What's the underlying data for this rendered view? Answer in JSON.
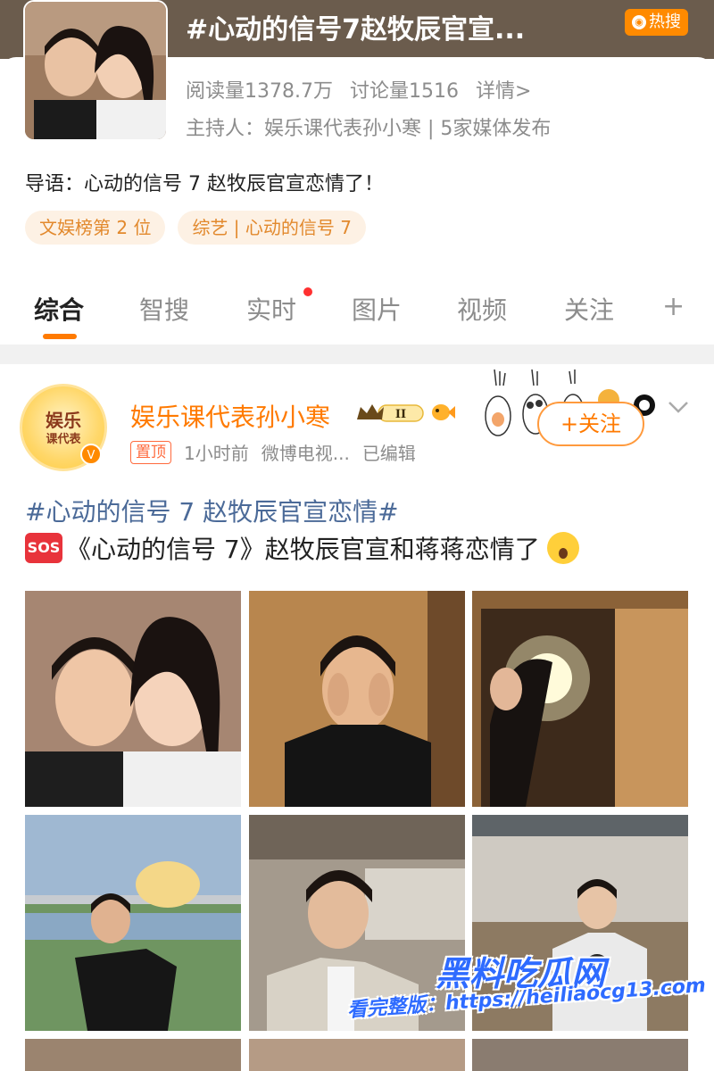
{
  "topic": {
    "title": "#心动的信号7赵牧辰官宣...",
    "hot_badge": "热搜",
    "reads": "阅读量1378.7万",
    "discussions": "讨论量1516",
    "details": "详情>",
    "host_line": "主持人：娱乐课代表孙小寒 | 5家媒体发布",
    "intro": "导语：心动的信号 7 赵牧辰官宣恋情了！",
    "chips": [
      "文娱榜第 2 位",
      "综艺 | 心动的信号 7"
    ]
  },
  "tabs": [
    "综合",
    "智搜",
    "实时",
    "图片",
    "视频",
    "关注"
  ],
  "tabs_plus": "+",
  "post": {
    "avatar_text_line1": "娱乐",
    "avatar_text_line2": "课代表",
    "author": "娱乐课代表孙小寒",
    "level_badge": "II",
    "pinned": "置顶",
    "time": "1小时前",
    "source": "微博电视...",
    "edited": "已编辑",
    "follow_label": "+关注",
    "hashtag": "#心动的信号 7 赵牧辰官宣恋情#",
    "sos_label": "SOS",
    "body": "《心动的信号 7》赵牧辰官宣和蒋蒋恋情了"
  },
  "watermark": {
    "brand": "黑料吃瓜网",
    "url_line": "看完整版：https://heiliaocg13.com"
  },
  "colors": {
    "accent": "#ff7a00",
    "hashtag": "#4b6a98",
    "header_band": "#6b5c4d",
    "watermark": "#2e6bff"
  }
}
